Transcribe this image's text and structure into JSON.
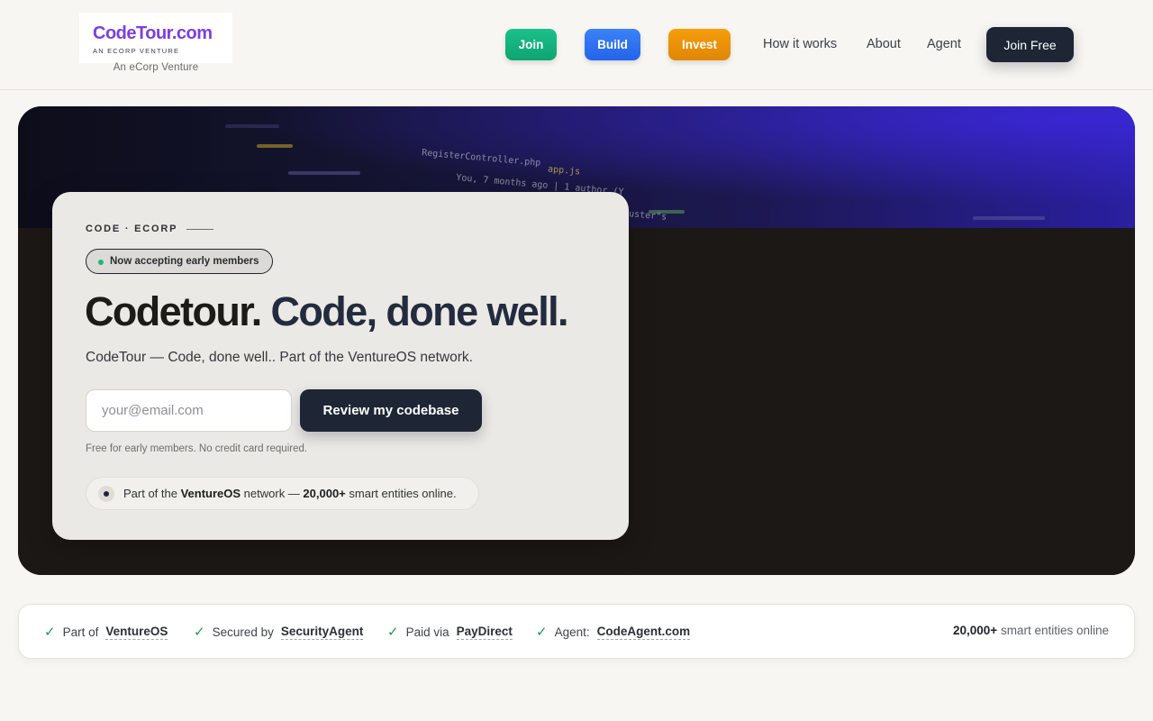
{
  "header": {
    "logo_text": "CodeTour.com",
    "logo_sub": "AN ECORP VENTURE",
    "logo_caption": "An eCorp Venture",
    "colored_buttons": [
      {
        "label": "Join",
        "color": "#10b981"
      },
      {
        "label": "Build",
        "color": "#2f7df4"
      },
      {
        "label": "Invest",
        "color": "#f09a0c"
      }
    ],
    "nav_links": [
      "How it works",
      "About",
      "Agent"
    ],
    "cta_label": "Join Free"
  },
  "hero": {
    "eyebrow": "CODE · ECORP",
    "badge": "Now accepting early members",
    "headline_main": "Codetour.",
    "headline_accent": "Code, done well.",
    "subcopy": "CodeTour — Code, done well.. Part of the VentureOS network.",
    "email_placeholder": "your@email.com",
    "submit_label": "Review my codebase",
    "fineprint": "Free for early members. No credit card required.",
    "network": {
      "prefix": "Part of the ",
      "brand": "VentureOS",
      "middle": " network — ",
      "count": "20,000+",
      "suffix": " smart entities online."
    },
    "code_snippets": [
      "RegisterController.php",
      "app.js",
      "You, 7 months ago | 1 author (Y",
      "uster\"s"
    ]
  },
  "trust_bar": {
    "items": [
      {
        "label": "Part of",
        "link": "VentureOS"
      },
      {
        "label": "Secured by",
        "link": "SecurityAgent"
      },
      {
        "label": "Paid via",
        "link": "PayDirect"
      },
      {
        "label": "Agent:",
        "link": "CodeAgent.com"
      }
    ],
    "count": "20,000+",
    "count_suffix": " smart entities online"
  },
  "colors": {
    "navy": "#1e2535",
    "page_bg": "#f8f6f2",
    "check_green": "#1a9a5e",
    "logo_purple": "#7b3fe0"
  }
}
